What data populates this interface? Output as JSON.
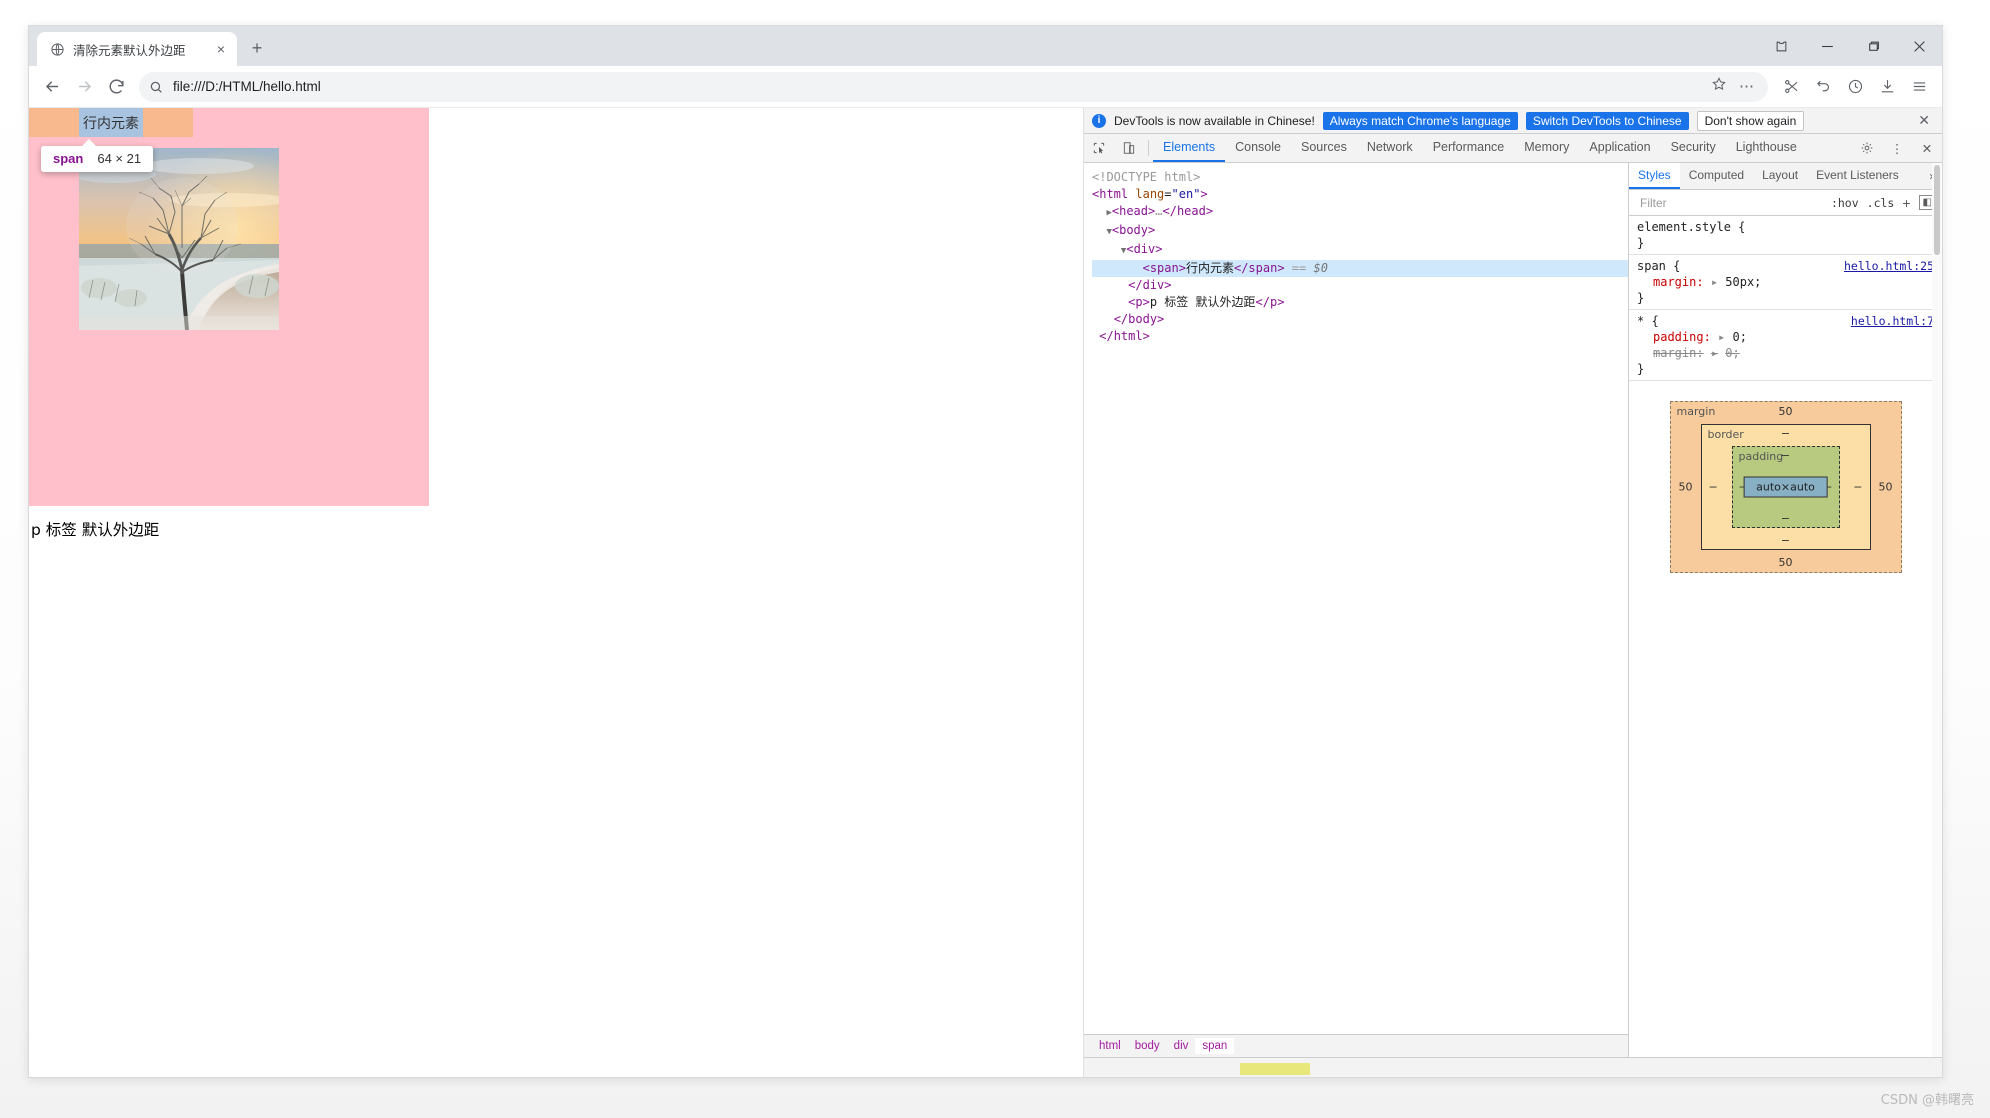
{
  "browser": {
    "tab": {
      "title": "清除元素默认外边距",
      "favicon": "globe-icon",
      "close": "×"
    },
    "new_tab": "+",
    "window_controls": {
      "collections": "collections-icon",
      "minimize": "−",
      "maximize": "▢",
      "close": "✕"
    },
    "nav": {
      "back": "←",
      "forward": "→",
      "reload": "⟳",
      "search_icon": "search-icon",
      "url": "file:///D:/HTML/hello.html",
      "star": "☆",
      "more": "⋯",
      "cut": "scissors-icon",
      "undo": "undo-icon",
      "history": "clock-icon",
      "download": "download-icon",
      "menu": "hamburger-icon"
    }
  },
  "page": {
    "span_text": "行内元素",
    "p_text": "p 标签 默认外边距",
    "tooltip": {
      "tag": "span",
      "dims": "64 × 21"
    },
    "colors": {
      "body_bg": "#ffc0cb",
      "margin_highlight": "#f8b98f",
      "content_highlight": "#a7c3e0"
    }
  },
  "devtools": {
    "notice": {
      "icon": "info-icon",
      "message": "DevTools is now available in Chinese!",
      "btn_always": "Always match Chrome's language",
      "btn_switch": "Switch DevTools to Chinese",
      "btn_dismiss": "Don't show again",
      "close": "✕"
    },
    "toolbar": {
      "inspect": "inspect-icon",
      "device": "device-toggle-icon",
      "settings": "gear-icon",
      "more": "⋮",
      "close": "✕"
    },
    "tabs": [
      {
        "label": "Elements",
        "active": true
      },
      {
        "label": "Console",
        "active": false
      },
      {
        "label": "Sources",
        "active": false
      },
      {
        "label": "Network",
        "active": false
      },
      {
        "label": "Performance",
        "active": false
      },
      {
        "label": "Memory",
        "active": false
      },
      {
        "label": "Application",
        "active": false
      },
      {
        "label": "Security",
        "active": false
      },
      {
        "label": "Lighthouse",
        "active": false
      }
    ],
    "dom": [
      {
        "indent": 0,
        "html": "&lt;!DOCTYPE html&gt;",
        "kind": "doctype"
      },
      {
        "indent": 0,
        "html": "&lt;html lang=\"en\"&gt;",
        "kind": "tag"
      },
      {
        "indent": 1,
        "html": "&lt;head&gt;…&lt;/head&gt;",
        "kind": "collapsed"
      },
      {
        "indent": 1,
        "html": "&lt;body&gt;",
        "kind": "open"
      },
      {
        "indent": 2,
        "html": "&lt;div&gt;",
        "kind": "open"
      },
      {
        "indent": 3,
        "html": "&lt;span&gt;行内元素&lt;/span&gt; == $0",
        "kind": "selected"
      },
      {
        "indent": 2,
        "html": "&lt;/div&gt;",
        "kind": "close"
      },
      {
        "indent": 2,
        "html": "&lt;p&gt;p 标签 默认外边距&lt;/p&gt;",
        "kind": "tag"
      },
      {
        "indent": 1,
        "html": "&lt;/body&gt;",
        "kind": "close"
      },
      {
        "indent": 0,
        "html": "&lt;/html&gt;",
        "kind": "close"
      }
    ],
    "breadcrumbs": [
      {
        "label": "html",
        "active": false
      },
      {
        "label": "body",
        "active": false
      },
      {
        "label": "div",
        "active": false
      },
      {
        "label": "span",
        "active": true
      }
    ],
    "sidebar": {
      "tabs": [
        {
          "label": "Styles",
          "active": true
        },
        {
          "label": "Computed",
          "active": false
        },
        {
          "label": "Layout",
          "active": false
        },
        {
          "label": "Event Listeners",
          "active": false
        },
        {
          "label": "more",
          "active": false
        }
      ],
      "more_glyph": "»",
      "filter_placeholder": "Filter",
      "hov": ":hov",
      "cls": ".cls",
      "plus": "+",
      "toggle_sidebar": "◧",
      "rules": [
        {
          "selector": "element.style {",
          "source": "",
          "declarations": [],
          "close": "}"
        },
        {
          "selector": "span {",
          "source": "hello.html:25",
          "declarations": [
            {
              "prop": "margin:",
              "value": "50px;",
              "struck": false,
              "expander": "▸"
            }
          ],
          "close": "}"
        },
        {
          "selector": "* {",
          "source": "hello.html:7",
          "declarations": [
            {
              "prop": "padding:",
              "value": "0;",
              "struck": false,
              "expander": "▸"
            },
            {
              "prop": "margin:",
              "value": "0;",
              "struck": true,
              "expander": "▸"
            }
          ],
          "close": "}"
        }
      ],
      "box_model": {
        "margin_label": "margin",
        "border_label": "border",
        "padding_label": "padding",
        "content": "auto×auto",
        "margin_top": "50",
        "margin_right": "50",
        "margin_bottom": "50",
        "margin_left": "50",
        "border_top": "−",
        "border_right": "−",
        "border_bottom": "−",
        "border_left": "−",
        "padding_top": "−",
        "padding_right": "−",
        "padding_bottom": "−",
        "padding_left": "−"
      }
    }
  },
  "watermark": "CSDN @韩曙亮"
}
